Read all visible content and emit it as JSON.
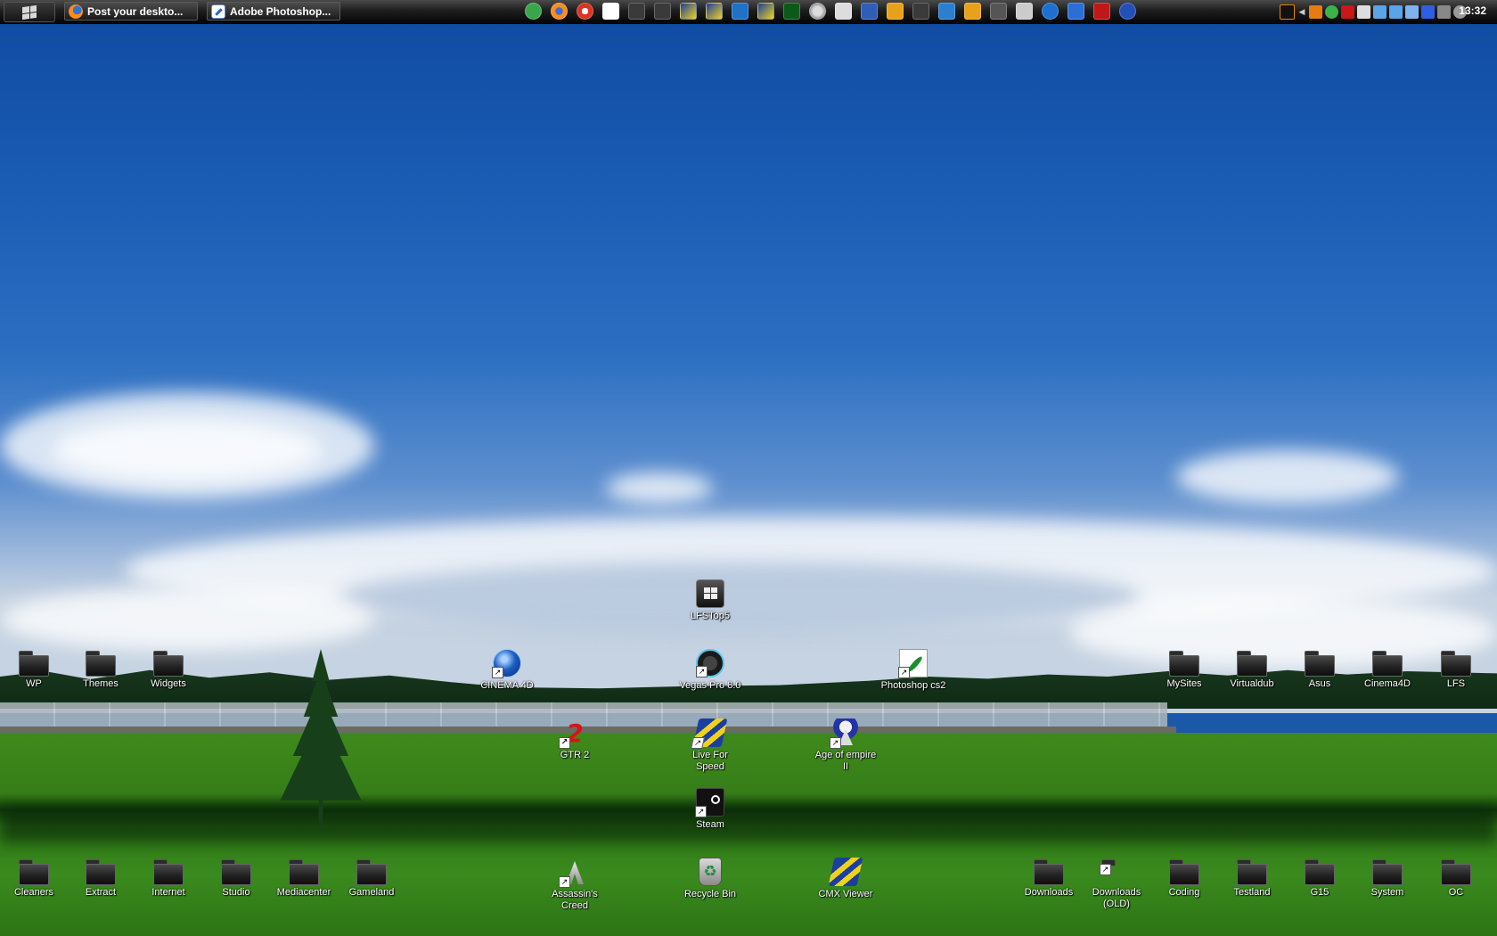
{
  "taskbar": {
    "start_icon": "windows-logo-icon",
    "tasks": [
      {
        "label": "Post your deskto...",
        "icon": "firefox-icon"
      },
      {
        "label": "Adobe Photoshop...",
        "icon": "photoshop-icon"
      }
    ],
    "quick_launch_count": 24,
    "clock": "13:32"
  },
  "desktop": {
    "icons": {
      "wp": "WP",
      "themes": "Themes",
      "widgets": "Widgets",
      "cinema4d_app": "CINEMA 4D",
      "lfstop5": "LFSTop5",
      "vegas": "Vegas Pro 8.0",
      "photoshop": "Photoshop cs2",
      "mysites": "MySites",
      "virtualdub": "Virtualdub",
      "asus": "Asus",
      "cinema4d_folder": "Cinema4D",
      "lfs": "LFS",
      "gtr2": "GTR 2",
      "live_for_speed": "Live For Speed",
      "age_of_empire": "Age of empire II",
      "steam": "Steam",
      "cleaners": "Cleaners",
      "extract": "Extract",
      "internet": "Internet",
      "studio": "Studio",
      "mediacenter": "Mediacenter",
      "gameland": "Gameland",
      "assassins_creed": "Assassin's Creed",
      "recycle_bin": "Recycle Bin",
      "cmx_viewer": "CMX Viewer",
      "downloads": "Downloads",
      "downloads_old": "Downloads (OLD)",
      "coding": "Coding",
      "testland": "Testland",
      "g15": "G15",
      "system": "System",
      "oc": "OC"
    }
  }
}
